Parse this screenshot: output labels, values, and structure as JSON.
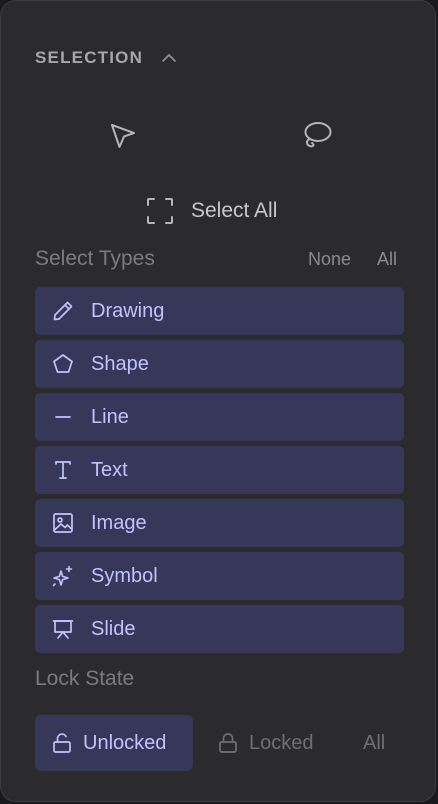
{
  "section": {
    "title": "SELECTION",
    "collapse_icon": "chevron-up-icon"
  },
  "tools": [
    {
      "name": "pointer",
      "icon": "pointer-cursor-icon"
    },
    {
      "name": "lasso",
      "icon": "lasso-icon"
    }
  ],
  "select_all": {
    "label": "Select All",
    "icon": "select-all-frame-icon"
  },
  "select_types": {
    "label": "Select Types",
    "none_label": "None",
    "all_label": "All",
    "items": [
      {
        "label": "Drawing",
        "icon": "pencil-icon"
      },
      {
        "label": "Shape",
        "icon": "pentagon-icon"
      },
      {
        "label": "Line",
        "icon": "line-icon"
      },
      {
        "label": "Text",
        "icon": "text-icon"
      },
      {
        "label": "Image",
        "icon": "image-icon"
      },
      {
        "label": "Symbol",
        "icon": "sparkles-icon"
      },
      {
        "label": "Slide",
        "icon": "presentation-icon"
      }
    ]
  },
  "lock_state": {
    "label": "Lock State",
    "options": [
      {
        "label": "Unlocked",
        "icon": "unlock-icon",
        "selected": true
      },
      {
        "label": "Locked",
        "icon": "lock-icon",
        "selected": false
      },
      {
        "label": "All",
        "selected": false
      }
    ]
  },
  "colors": {
    "panel_bg": "#2b2b2d",
    "item_bg": "#37375a",
    "accent_text": "#c1c3ff",
    "muted_text": "#7b7b80"
  }
}
